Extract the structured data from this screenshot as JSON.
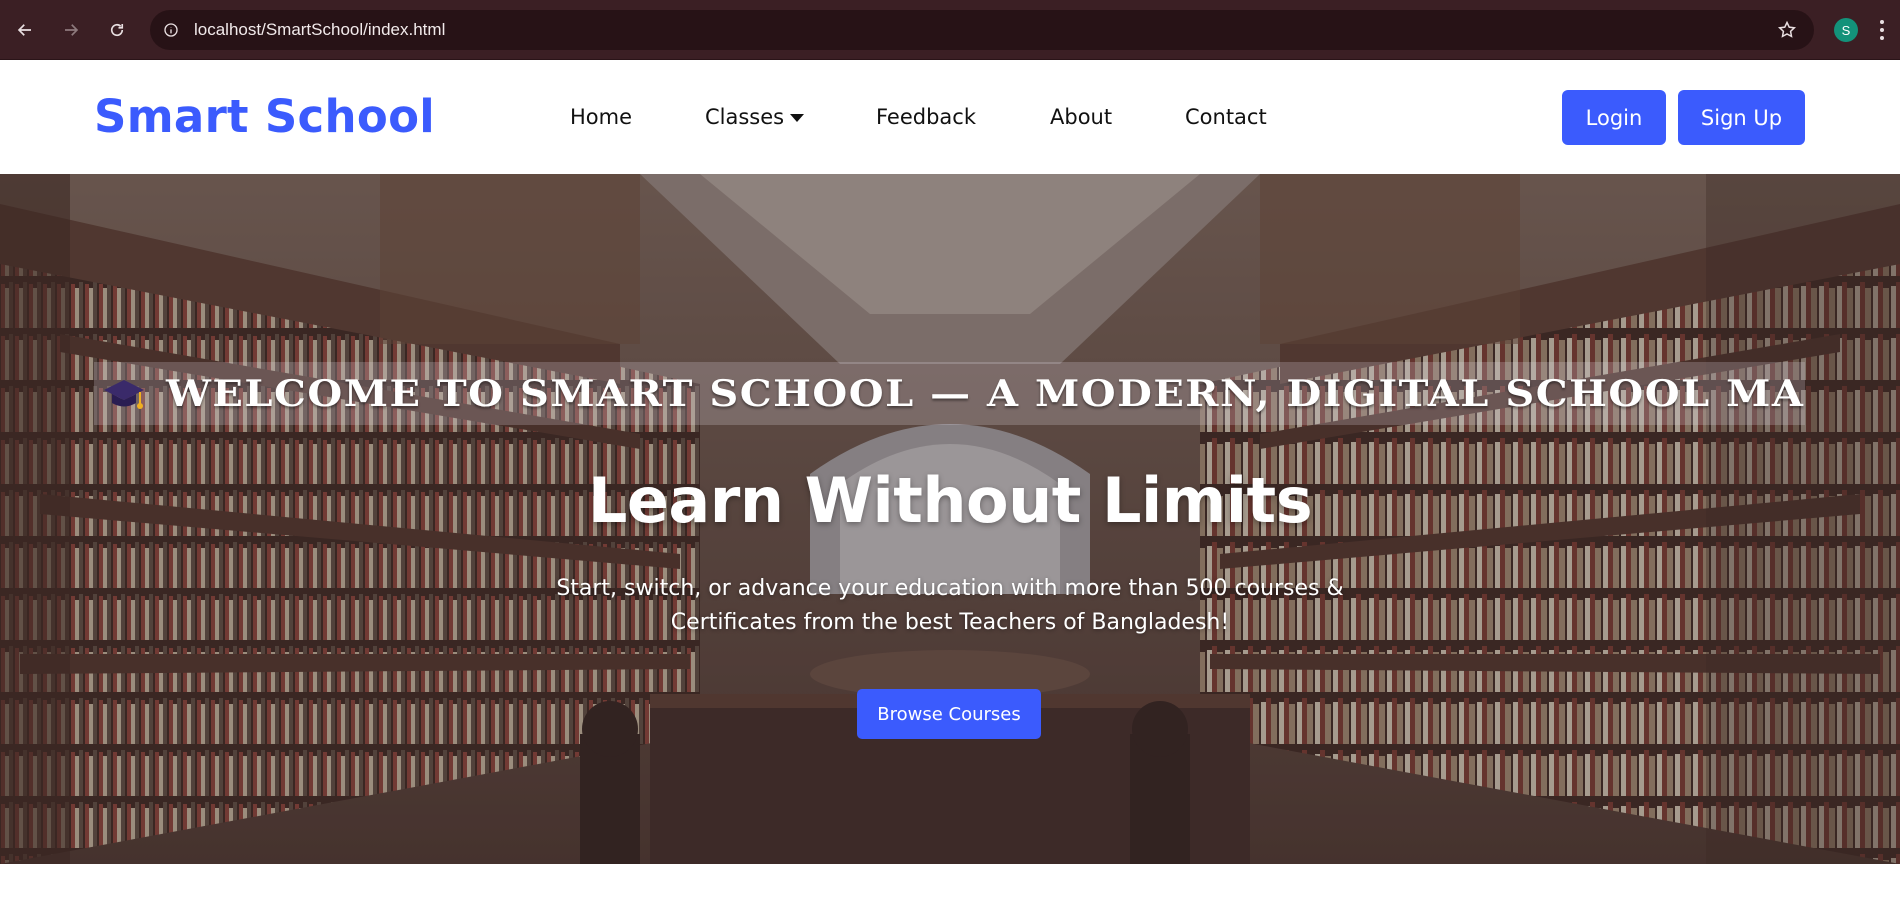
{
  "browser": {
    "url": "localhost/SmartSchool/index.html",
    "profile_initial": "S",
    "profile_color": "#13927a"
  },
  "site": {
    "brand": "Smart School",
    "brand_color": "#3b5bfd",
    "nav": [
      {
        "label": "Home"
      },
      {
        "label": "Classes",
        "has_dropdown": true
      },
      {
        "label": "Feedback"
      },
      {
        "label": "About"
      },
      {
        "label": "Contact"
      }
    ],
    "login_label": "Login",
    "signup_label": "Sign Up"
  },
  "hero": {
    "marquee_icon": "graduation-cap-icon",
    "marquee_text": "WELCOME TO SMART SCHOOL — A MODERN, DIGITAL SCHOOL MA",
    "title": "Learn Without Limits",
    "subtitle_line1": "Start, switch, or advance your education with more than 500 courses &",
    "subtitle_line2": "Certificates from the best Teachers of Bangladesh!",
    "cta_label": "Browse Courses"
  }
}
